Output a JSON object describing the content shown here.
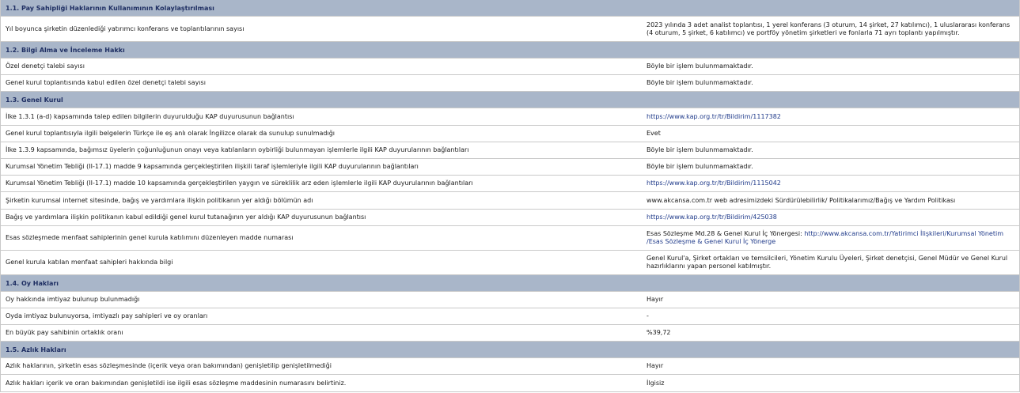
{
  "sections": [
    {
      "title": "1.1. Pay Sahipliği Haklarının Kullanımının Kolaylaştırılması",
      "rows": [
        {
          "q": "Yıl boyunca şirketin düzenlediği yatırımcı konferans ve toplantılarının sayısı",
          "a": "2023 yılında 3 adet analist toplantısı, 1 yerel konferans (3 oturum, 14 şirket, 27 katılımcı), 1 uluslararası konferans (4 oturum, 5 şirket, 6 katılımcı) ve portföy yönetim şirketleri ve fonlarla 71 ayrı toplantı yapılmıştır."
        }
      ]
    },
    {
      "title": "1.2. Bilgi Alma ve İnceleme Hakkı",
      "rows": [
        {
          "q": "Özel denetçi talebi sayısı",
          "a": "Böyle bir işlem bulunmamaktadır."
        },
        {
          "q": "Genel kurul toplantısında kabul edilen özel denetçi talebi sayısı",
          "a": "Böyle bir işlem bulunmamaktadır."
        }
      ]
    },
    {
      "title": "1.3. Genel Kurul",
      "rows": [
        {
          "q": "İlke 1.3.1 (a-d) kapsamında talep edilen bilgilerin duyurulduğu KAP duyurusunun bağlantısı",
          "a": "https://www.kap.org.tr/tr/Bildirim/1117382"
        },
        {
          "q": "Genel kurul toplantısıyla ilgili belgelerin Türkçe ile eş anlı olarak İngilizce olarak da sunulup sunulmadığı",
          "a": "Evet"
        },
        {
          "q": "İlke 1.3.9 kapsamında, bağımsız üyelerin çoğunluğunun onayı veya katılanların oybirliği bulunmayan işlemlerle ilgili KAP duyurularının bağlantıları",
          "a": "Böyle bir işlem bulunmamaktadır."
        },
        {
          "q": "Kurumsal Yönetim Tebliği (II-17.1) madde 9 kapsamında gerçekleştirilen ilişkili taraf işlemleriyle ilgili KAP duyurularının bağlantıları",
          "a": "Böyle bir işlem bulunmamaktadır."
        },
        {
          "q": "Kurumsal Yönetim Tebliği (II-17.1) madde 10 kapsamında gerçekleştirilen yaygın ve süreklilik arz eden işlemlerle ilgili KAP duyurularının bağlantıları",
          "a": "https://www.kap.org.tr/tr/Bildirim/1115042"
        },
        {
          "q": "Şirketin kurumsal internet sitesinde, bağış ve yardımlara ilişkin politikanın yer aldığı bölümün adı",
          "a": "www.akcansa.com.tr web adresimizdeki Sürdürülebilirlik/ Politikalarımız/Bağış ve Yardım Politikası"
        },
        {
          "q": "Bağış ve yardımlara ilişkin politikanın kabul edildiği genel kurul tutanağının yer aldığı KAP duyurusunun bağlantısı",
          "a": "https://www.kap.org.tr/tr/Bildirim/425038"
        },
        {
          "q": "Esas sözleşmede menfaat sahiplerinin genel kurula katılımını düzenleyen madde numarası",
          "a": "Esas Sözleşme Md.28 & Genel Kurul İç Yönergesi: ",
          "a_link": "http://www.akcansa.com.tr/Yatirimci İlişkileri/Kurumsal Yönetim /Esas Sözleşme & Genel Kurul İç Yönerge"
        },
        {
          "q": "Genel kurula katılan menfaat sahipleri hakkında bilgi",
          "a": "Genel Kurul'a, Şirket ortakları ve temsilcileri, Yönetim Kurulu Üyeleri, Şirket denetçisi, Genel Müdür ve Genel Kurul hazırlıklarını yapan personel katılmıştır."
        }
      ]
    },
    {
      "title": "1.4. Oy Hakları",
      "rows": [
        {
          "q": "Oy hakkında imtiyaz bulunup bulunmadığı",
          "a": "Hayır"
        },
        {
          "q": "Oyda imtiyaz bulunuyorsa, imtiyazlı pay sahipleri ve oy oranları",
          "a": "-"
        },
        {
          "q": "En büyük pay sahibinin ortaklık oranı",
          "a": "%39,72"
        }
      ]
    },
    {
      "title": "1.5. Azlık Hakları",
      "rows": [
        {
          "q": "Azlık haklarının, şirketin esas sözleşmesinde (içerik veya oran bakımından) genişletilip genişletilmediği",
          "a": "Hayır"
        },
        {
          "q": " Azlık hakları içerik ve oran bakımından genişletildi ise ilgili esas sözleşme maddesinin numarasını belirtiniz.",
          "a": "İlgisiz"
        }
      ]
    }
  ]
}
